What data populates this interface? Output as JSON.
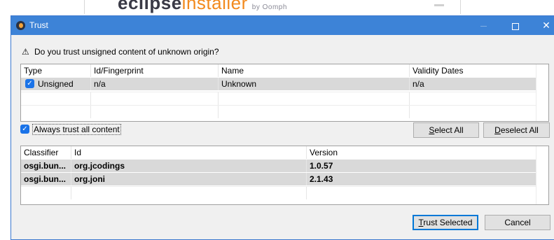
{
  "background": {
    "logo_main": "eclipse",
    "logo_accent": "installer",
    "logo_by": "by Oomph"
  },
  "window": {
    "title": "Trust",
    "controls": {
      "minimize": "—",
      "maximize": "□",
      "close": "✕"
    }
  },
  "question": "Do you trust unsigned content of unknown origin?",
  "certificates_table": {
    "columns": [
      "Type",
      "Id/Fingerprint",
      "Name",
      "Validity Dates"
    ],
    "rows": [
      {
        "checked": true,
        "type": "Unsigned",
        "fingerprint": "n/a",
        "name": "Unknown",
        "validity": "n/a"
      }
    ]
  },
  "always_trust": {
    "checked": true,
    "label": "Always trust all content"
  },
  "buttons": {
    "select_all": {
      "mnemonic": "S",
      "rest": "elect All"
    },
    "deselect_all": {
      "mnemonic": "D",
      "rest": "eselect All"
    },
    "trust_selected": {
      "mnemonic": "T",
      "rest": "rust Selected"
    },
    "cancel": "Cancel"
  },
  "artifacts_table": {
    "columns": [
      "Classifier",
      "Id",
      "Version"
    ],
    "rows": [
      {
        "classifier": "osgi.bun...",
        "id": "org.jcodings",
        "version": "1.0.57"
      },
      {
        "classifier": "osgi.bun...",
        "id": "org.joni",
        "version": "2.1.43"
      }
    ]
  },
  "colors": {
    "titlebar": "#3d83d7",
    "selection": "#d9d9d9",
    "checkbox": "#1a73e8",
    "default_button_border": "#0078d7"
  }
}
